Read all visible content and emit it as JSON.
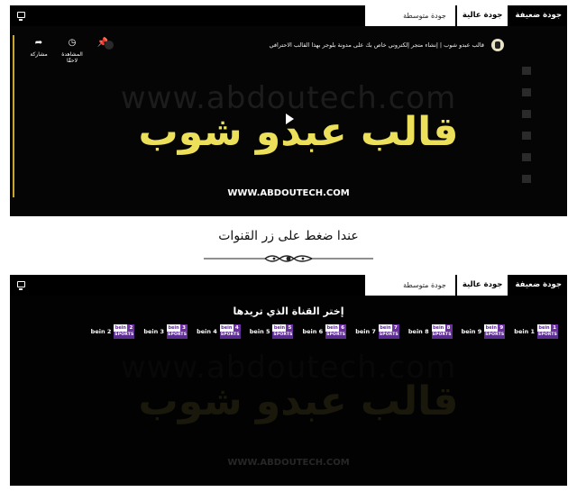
{
  "tabs": {
    "low": "جودة ضعيفة",
    "high": "جودة عالية",
    "medium": "جودة متوسطة"
  },
  "video": {
    "title": "قالب عبدو شوب | إنشاء متجر إلكتروني خاص بك على مدونة بلوجر بهذا القالب الاحترافي",
    "watermark": "www.abdoutech.com",
    "logo_text": "قالب عبدو شوب",
    "site_text": "WWW.ABDOUTECH.COM",
    "controls": {
      "share": "مشاركة",
      "watch_later": "المشاهدة لاحقًا"
    }
  },
  "caption": "عندا ضغط على زر القنوات",
  "chooser": {
    "title": "إختر القناة الذي تريدها",
    "channels": [
      {
        "name": "bein 1",
        "number": "1"
      },
      {
        "name": "bein 9",
        "number": "9"
      },
      {
        "name": "bein 8",
        "number": "8"
      },
      {
        "name": "bein 7",
        "number": "7"
      },
      {
        "name": "bein 6",
        "number": "6"
      },
      {
        "name": "bein 5",
        "number": "5"
      },
      {
        "name": "bein 4",
        "number": "4"
      },
      {
        "name": "bein 3",
        "number": "3"
      },
      {
        "name": "bein 2",
        "number": "2"
      }
    ],
    "logo_word": "bein",
    "logo_sub": "SPORTS"
  },
  "colors": {
    "accent": "#c9a52a",
    "logo_yellow": "#ece05b",
    "bein_purple": "#5c2d91"
  }
}
